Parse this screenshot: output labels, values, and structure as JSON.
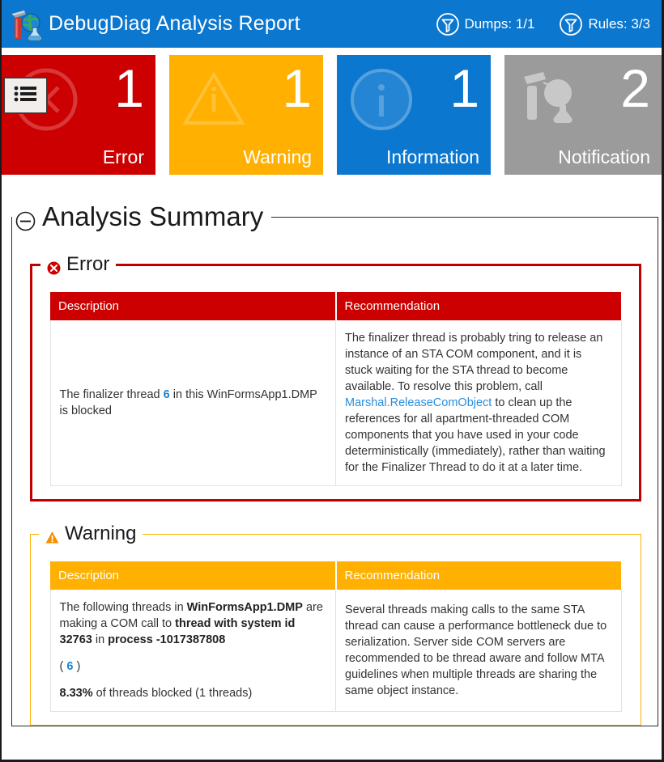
{
  "header": {
    "logo_icon": "debugdiag-logo-icon",
    "title": "DebugDiag Analysis Report",
    "stats": [
      {
        "icon": "funnel-icon",
        "label": "Dumps: 1/1"
      },
      {
        "icon": "funnel-icon",
        "label": "Rules: 3/3"
      }
    ],
    "background_color": "#0b77cf"
  },
  "menu_button": {
    "icon": "list-menu-icon"
  },
  "tiles": [
    {
      "count": "1",
      "label": "Error",
      "color": "#cc0000",
      "glyph": "error-circle-x-icon"
    },
    {
      "count": "1",
      "label": "Warning",
      "color": "#ffb000",
      "glyph": "warning-triangle-icon"
    },
    {
      "count": "1",
      "label": "Information",
      "color": "#0b77cf",
      "glyph": "information-circle-icon"
    },
    {
      "count": "2",
      "label": "Notification",
      "color": "#9b9b9b",
      "glyph": "debug-tools-icon"
    }
  ],
  "summary": {
    "title": "Analysis Summary",
    "collapse_icon": "minus-circle-icon"
  },
  "error_section": {
    "legend": "Error",
    "icon": "error-circle-x-icon",
    "accent_color": "#c00000",
    "columns": [
      "Description",
      "Recommendation"
    ],
    "rows": [
      {
        "description_pre": "The finalizer thread ",
        "description_link": "6",
        "description_post": " in this WinFormsApp1.DMP is blocked",
        "recommendation_pre": "The finalizer thread is probably tring to release an instance of an STA COM component, and it is stuck waiting for the STA thread to become available. To resolve this problem, call ",
        "recommendation_link": "Marshal.ReleaseComObject",
        "recommendation_post": " to clean up the references for all apartment-threaded COM components that you have used in your code deterministically (immediately), rather than waiting for the Finalizer Thread to do it at a later time."
      }
    ]
  },
  "warning_section": {
    "legend": "Warning",
    "icon": "warning-triangle-icon",
    "accent_color": "#ffb000",
    "columns": [
      "Description",
      "Recommendation"
    ],
    "rows": [
      {
        "desc_l1": "The following threads in ",
        "desc_b1": "WinFormsApp1.DMP",
        "desc_l2": " are making a COM call to ",
        "desc_b2": "thread with system id 32763",
        "desc_l3": " in ",
        "desc_b3": "process -1017387808",
        "desc_paren_open": "( ",
        "desc_link": "6",
        "desc_paren_close": " )",
        "desc_pct": "8.33%",
        "desc_pct_rest": " of threads blocked (1 threads)",
        "recommendation": "Several threads making calls to the same STA thread can cause a performance bottleneck due to serialization. Server side COM servers are recommended to be thread aware and follow MTA guidelines when multiple threads are sharing the same object instance."
      }
    ]
  }
}
